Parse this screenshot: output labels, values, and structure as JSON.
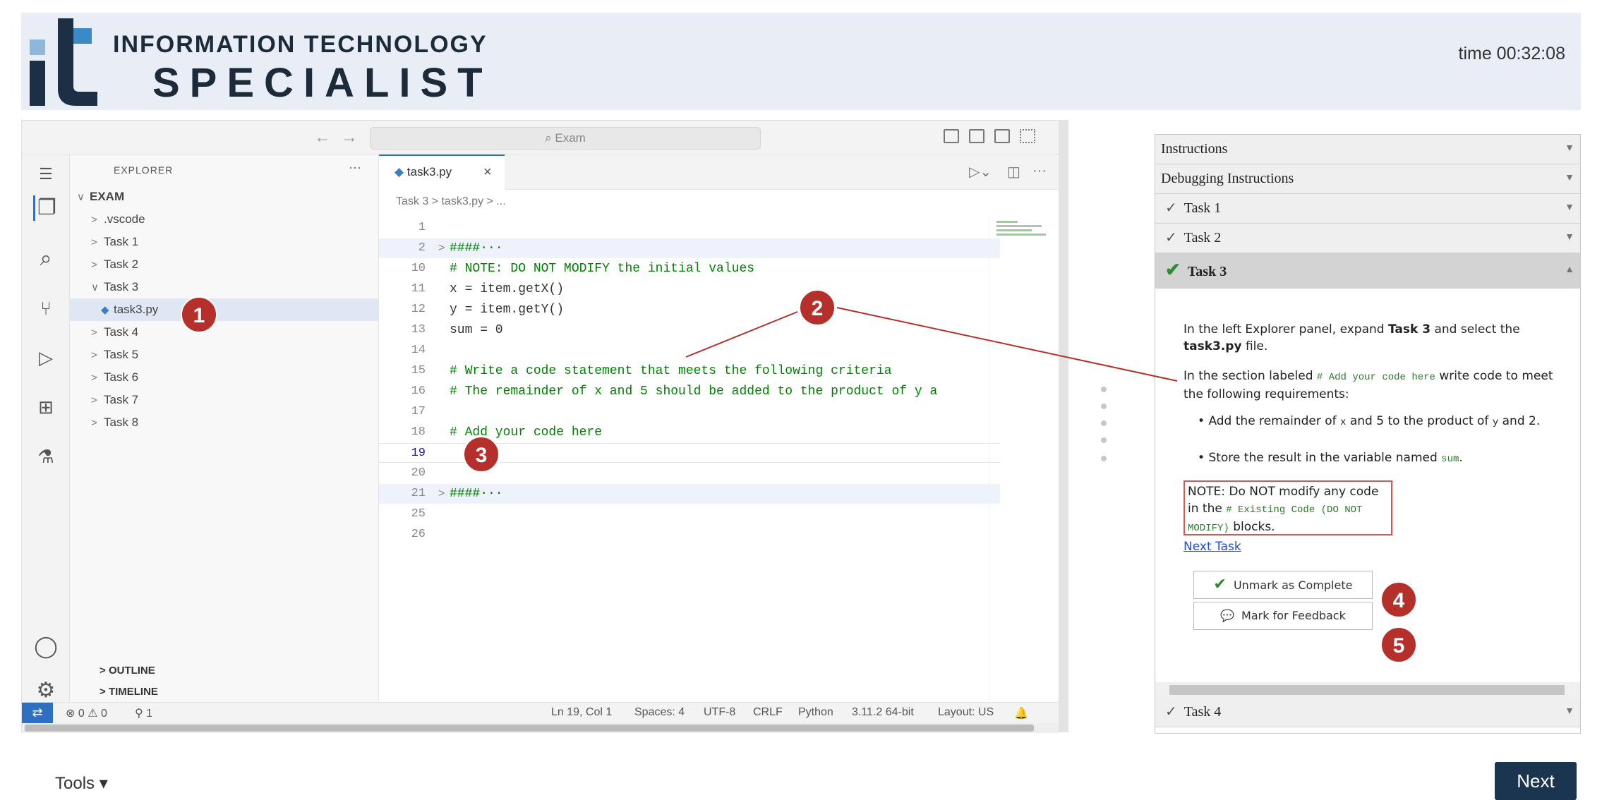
{
  "header": {
    "logo_line1": "INFORMATION TECHNOLOGY",
    "logo_line2": "SPECIALIST",
    "timer": "time 00:32:08"
  },
  "vscode": {
    "search_placeholder": "Exam",
    "explorer": {
      "title": "EXPLORER",
      "more": "···",
      "items": [
        {
          "chev": "∨",
          "label": "EXAM"
        },
        {
          "chev": ">",
          "label": ".vscode"
        },
        {
          "chev": ">",
          "label": "Task 1"
        },
        {
          "chev": ">",
          "label": "Task 2"
        },
        {
          "chev": "∨",
          "label": "Task 3"
        },
        {
          "chev": "",
          "label": "task3.py"
        },
        {
          "chev": ">",
          "label": "Task 4"
        },
        {
          "chev": ">",
          "label": "Task 5"
        },
        {
          "chev": ">",
          "label": "Task 6"
        },
        {
          "chev": ">",
          "label": "Task 7"
        },
        {
          "chev": ">",
          "label": "Task 8"
        }
      ],
      "outline": "OUTLINE",
      "timeline": "TIMELINE"
    },
    "tab": {
      "label": "task3.py",
      "close": "×"
    },
    "breadcrumb": "Task 3 > task3.py > ...",
    "code_lines": [
      {
        "num": "1",
        "text": "",
        "type": "plain"
      },
      {
        "num": "2",
        "text": "####···",
        "type": "comment",
        "fold": ">"
      },
      {
        "num": "10",
        "text": "# NOTE: DO NOT MODIFY the initial values",
        "type": "comment"
      },
      {
        "num": "11",
        "text": "x = item.getX()",
        "type": "plain"
      },
      {
        "num": "12",
        "text": "y = item.getY()",
        "type": "plain"
      },
      {
        "num": "13",
        "text": "sum = 0",
        "type": "plain"
      },
      {
        "num": "14",
        "text": "",
        "type": "plain"
      },
      {
        "num": "15",
        "text": "# Write a code statement that meets the following criteria",
        "type": "comment"
      },
      {
        "num": "16",
        "text": "# The remainder of x and 5 should be added to the product of y a",
        "type": "comment"
      },
      {
        "num": "17",
        "text": "",
        "type": "plain"
      },
      {
        "num": "18",
        "text": "# Add your code here",
        "type": "comment"
      },
      {
        "num": "19",
        "text": "",
        "type": "plain"
      },
      {
        "num": "20",
        "text": "",
        "type": "plain"
      },
      {
        "num": "21",
        "text": "####···",
        "type": "comment",
        "fold": ">"
      },
      {
        "num": "25",
        "text": "",
        "type": "plain"
      },
      {
        "num": "26",
        "text": "",
        "type": "plain"
      }
    ],
    "status": {
      "problems": "⊗ 0 ⚠ 0",
      "ports": "⚲ 1",
      "position": "Ln 19, Col 1",
      "spaces": "Spaces: 4",
      "encoding": "UTF-8",
      "eol": "CRLF",
      "language": "Python",
      "interpreter": "3.11.2 64-bit",
      "layout": "Layout: US"
    }
  },
  "task_panel": {
    "sections": [
      {
        "label": "Instructions",
        "check": "",
        "state": "collapsed"
      },
      {
        "label": "Debugging Instructions",
        "check": "",
        "state": "collapsed"
      },
      {
        "label": "Task 1",
        "check": "outline",
        "state": "collapsed"
      },
      {
        "label": "Task 2",
        "check": "outline",
        "state": "collapsed"
      },
      {
        "label": "Task 3",
        "check": "green",
        "state": "expanded"
      }
    ],
    "task3": {
      "p1_a": "In the left Explorer panel, expand ",
      "p1_b": "Task 3",
      "p1_c": " and select the ",
      "p1_d": "task3.py",
      "p1_e": " file.",
      "p2_a": "In the section labeled ",
      "p2_code": "# Add your code here",
      "p2_b": " write code to meet the following requirements:",
      "bullet1_a": "Add the remainder of ",
      "bullet1_x": "x",
      "bullet1_b": " and 5 to the product of ",
      "bullet1_y": "y",
      "bullet1_c": " and 2.",
      "bullet2_a": "Store the result in the variable named ",
      "bullet2_code": "sum",
      "bullet2_b": ".",
      "note_a": "NOTE: Do NOT modify any code in the ",
      "note_code": "# Existing Code (DO NOT MODIFY)",
      "note_b": " blocks.",
      "next_task": "Next Task",
      "unmark_label": "Unmark as Complete",
      "feedback_label": "Mark for Feedback"
    },
    "task4_label": "Task 4"
  },
  "annotations": [
    "1",
    "2",
    "3",
    "4",
    "5"
  ],
  "footer": {
    "tools": "Tools ▾",
    "next": "Next"
  },
  "colors": {
    "badge": "#b6302b",
    "next_button": "#1b3550",
    "accent": "#1a73e8",
    "check": "#2e8b2e"
  }
}
